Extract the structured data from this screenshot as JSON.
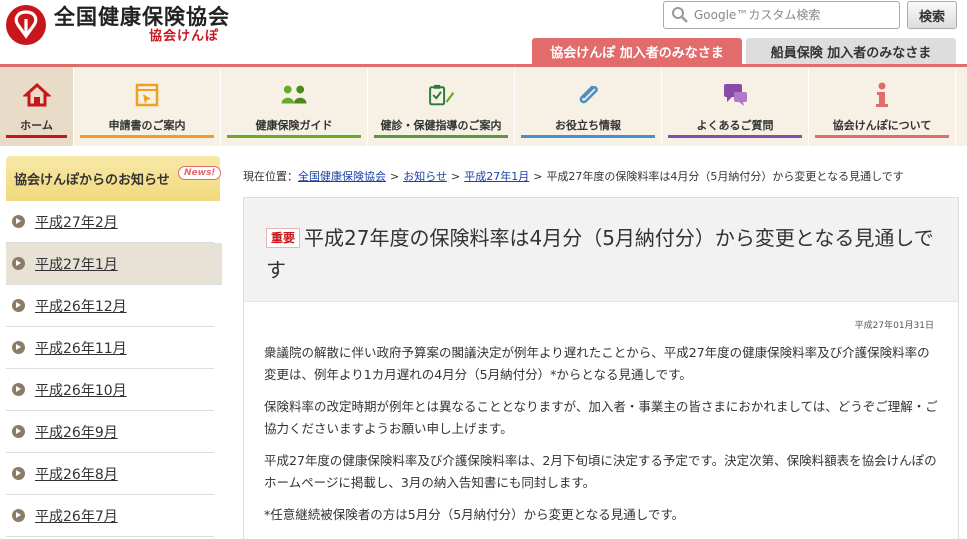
{
  "header": {
    "logo_main": "全国健康保険協会",
    "logo_sub": "協会けんぽ",
    "search_placeholder": "Google™カスタム検索",
    "search_button": "検索"
  },
  "user_tabs": [
    "協会けんぽ 加入者のみなさま",
    "船員保険 加入者のみなさま"
  ],
  "nav": {
    "items": [
      {
        "label": "ホーム",
        "icon": "home-icon",
        "color": "#c8161d"
      },
      {
        "label": "申請書のご案内",
        "icon": "application-form-icon",
        "color": "#f0a020"
      },
      {
        "label": "健康保険ガイド",
        "icon": "people-icon",
        "color": "#6aaa2a"
      },
      {
        "label": "健診・保健指導のご案内",
        "icon": "clipboard-check-icon",
        "color": "#5a9a3a"
      },
      {
        "label": "お役立ち情報",
        "icon": "paperclip-icon",
        "color": "#4a90c8"
      },
      {
        "label": "よくあるご質問",
        "icon": "chat-bubble-icon",
        "color": "#8a4aa8"
      },
      {
        "label": "協会けんぽについて",
        "icon": "info-icon",
        "color": "#e26b6b"
      }
    ]
  },
  "sidebar": {
    "heading": "協会けんぽからのお知らせ",
    "badge": "News!",
    "items": [
      {
        "label": "平成27年2月",
        "active": false
      },
      {
        "label": "平成27年1月",
        "active": true
      },
      {
        "label": "平成26年12月",
        "active": false
      },
      {
        "label": "平成26年11月",
        "active": false
      },
      {
        "label": "平成26年10月",
        "active": false
      },
      {
        "label": "平成26年9月",
        "active": false
      },
      {
        "label": "平成26年8月",
        "active": false
      },
      {
        "label": "平成26年7月",
        "active": false
      }
    ]
  },
  "breadcrumb": {
    "prefix": "現在位置：",
    "links": [
      "全国健康保険協会",
      "お知らせ",
      "平成27年1月"
    ],
    "separator": ">",
    "current": "平成27年度の保険料率は4月分（5月納付分）から変更となる見通しです"
  },
  "article": {
    "badge": "重要",
    "title": "平成27年度の保険料率は4月分（5月納付分）から変更となる見通しです",
    "date": "平成27年01月31日",
    "paragraphs": [
      "衆議院の解散に伴い政府予算案の閣議決定が例年より遅れたことから、平成27年度の健康保険料率及び介護保険料率の変更は、例年より1カ月遅れの4月分（5月納付分）*からとなる見通しです。",
      "保険料率の改定時期が例年とは異なることとなりますが、加入者・事業主の皆さまにおかれましては、どうぞご理解・ご協力くださいますようお願い申し上げます。",
      "平成27年度の健康保険料率及び介護保険料率は、2月下旬頃に決定する予定です。決定次第、保険料額表を協会けんぽのホームページに掲載し、3月の納入告知書にも同封します。",
      "*任意継続被保険者の方は5月分（5月納付分）から変更となる見通しです。"
    ]
  },
  "colors": {
    "brand_red": "#c8161d",
    "tab_pink": "#e26b6b",
    "nav_bg": "#f6f1e4",
    "sidebar_head": "#f1d97c",
    "link_blue": "#1a3fa6"
  }
}
